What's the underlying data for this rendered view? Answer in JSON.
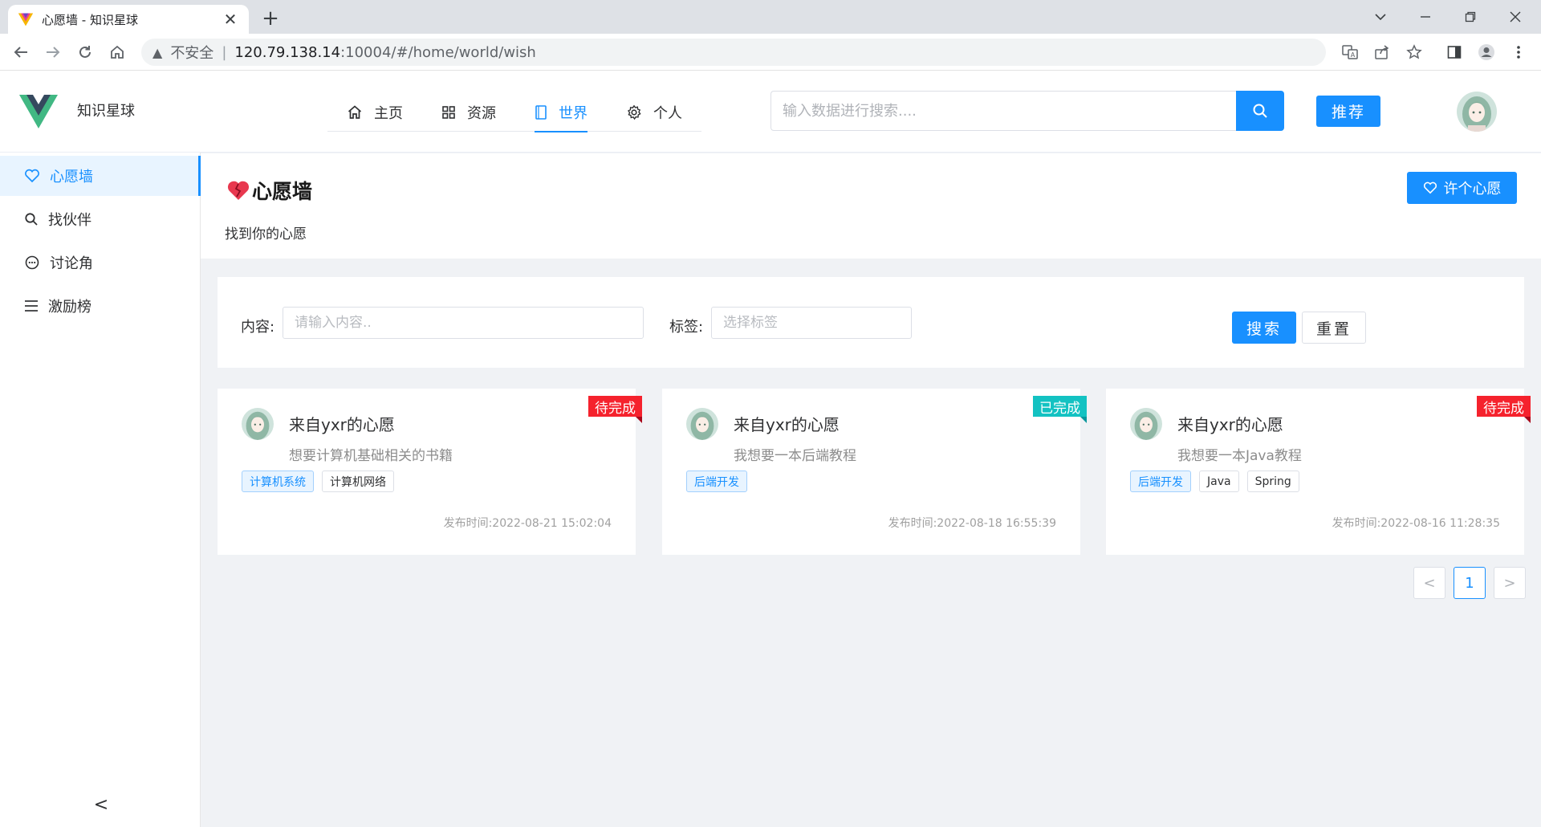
{
  "browser": {
    "tab_title": "心愿墙 - 知识星球",
    "address_insecure": "不安全",
    "address_separator": "|",
    "address_host": "120.79.138.14",
    "address_path": ":10004/#/home/world/wish"
  },
  "header": {
    "site_name": "知识星球",
    "nav": [
      {
        "label": "主页",
        "icon": "home-icon"
      },
      {
        "label": "资源",
        "icon": "grid-icon"
      },
      {
        "label": "世界",
        "icon": "book-icon",
        "active": true
      },
      {
        "label": "个人",
        "icon": "gear-icon"
      }
    ],
    "search_placeholder": "输入数据进行搜索....",
    "recommend_label": "推荐"
  },
  "sidebar": {
    "items": [
      {
        "label": "心愿墙",
        "icon": "heart-icon",
        "active": true
      },
      {
        "label": "找伙伴",
        "icon": "search-icon"
      },
      {
        "label": "讨论角",
        "icon": "chat-icon"
      },
      {
        "label": "激励榜",
        "icon": "menu-icon"
      }
    ],
    "collapse_label": "<"
  },
  "page": {
    "title": "心愿墙",
    "subtitle": "找到你的心愿",
    "wish_button": "许个心愿"
  },
  "filter": {
    "content_label": "内容:",
    "content_placeholder": "请输入内容..",
    "tag_label": "标签:",
    "tag_placeholder": "选择标签",
    "search_label": "搜索",
    "reset_label": "重置"
  },
  "cards": [
    {
      "title": "来自yxr的心愿",
      "desc": "想要计算机基础相关的书籍",
      "status": "待完成",
      "status_color": "#f5222d",
      "tags": [
        "计算机系统",
        "计算机网络"
      ],
      "time_label": "发布时间:",
      "time": "2022-08-21 15:02:04"
    },
    {
      "title": "来自yxr的心愿",
      "desc": "我想要一本后端教程",
      "status": "已完成",
      "status_color": "#13c2c2",
      "tags": [
        "后端开发"
      ],
      "time_label": "发布时间:",
      "time": "2022-08-18 16:55:39"
    },
    {
      "title": "来自yxr的心愿",
      "desc": "我想要一本Java教程",
      "status": "待完成",
      "status_color": "#f5222d",
      "tags": [
        "后端开发",
        "Java",
        "Spring"
      ],
      "time_label": "发布时间:",
      "time": "2022-08-16 11:28:35"
    }
  ],
  "pagination": {
    "prev": "<",
    "current": "1",
    "next": ">"
  },
  "colors": {
    "primary": "#1890ff",
    "danger": "#f5222d",
    "success_teal": "#13c2c2"
  }
}
